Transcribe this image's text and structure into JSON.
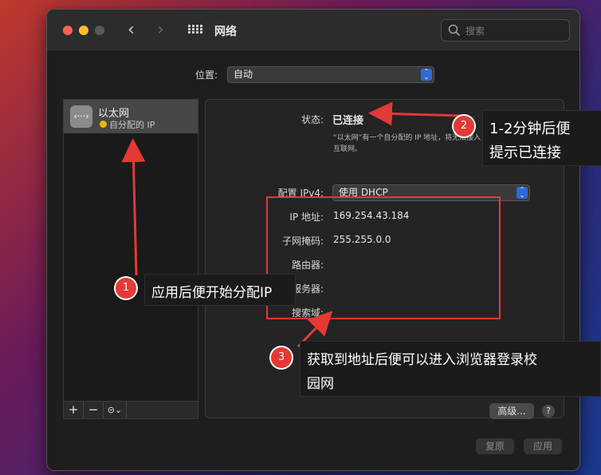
{
  "window": {
    "title": "网络",
    "search_placeholder": "搜索"
  },
  "location": {
    "label": "位置:",
    "value": "自动"
  },
  "sidebar": {
    "items": [
      {
        "name": "以太网",
        "status": "自分配的 IP",
        "status_color": "#f5b400"
      }
    ],
    "add_label": "+",
    "remove_label": "−",
    "action_label": "⊝⌄"
  },
  "detail": {
    "status_label": "状态:",
    "status_value": "已连接",
    "status_desc_line1": "“以太网”有一个自分配的 IP 地址，将无法接入",
    "status_desc_line2": "互联网。",
    "config_label": "配置 IPv4:",
    "config_value": "使用 DHCP",
    "ip_label": "IP 地址:",
    "ip_value": "169.254.43.184",
    "subnet_label": "子网掩码:",
    "subnet_value": "255.255.0.0",
    "router_label": "路由器:",
    "dns_label": "DNS 服务器:",
    "search_domain_label": "搜索域:",
    "advanced_label": "高级...",
    "help_label": "?"
  },
  "footer": {
    "revert_label": "复原",
    "apply_label": "应用"
  },
  "annotations": {
    "callout1_number": "1",
    "callout1_text": "应用后便开始分配IP",
    "callout2_number": "2",
    "callout2_line1": "1-2分钟后便",
    "callout2_line2": "提示已连接",
    "callout3_number": "3",
    "callout3_line1": "获取到地址后便可以进入浏览器登录校",
    "callout3_line2": "园网",
    "accent_color": "#e53935"
  }
}
